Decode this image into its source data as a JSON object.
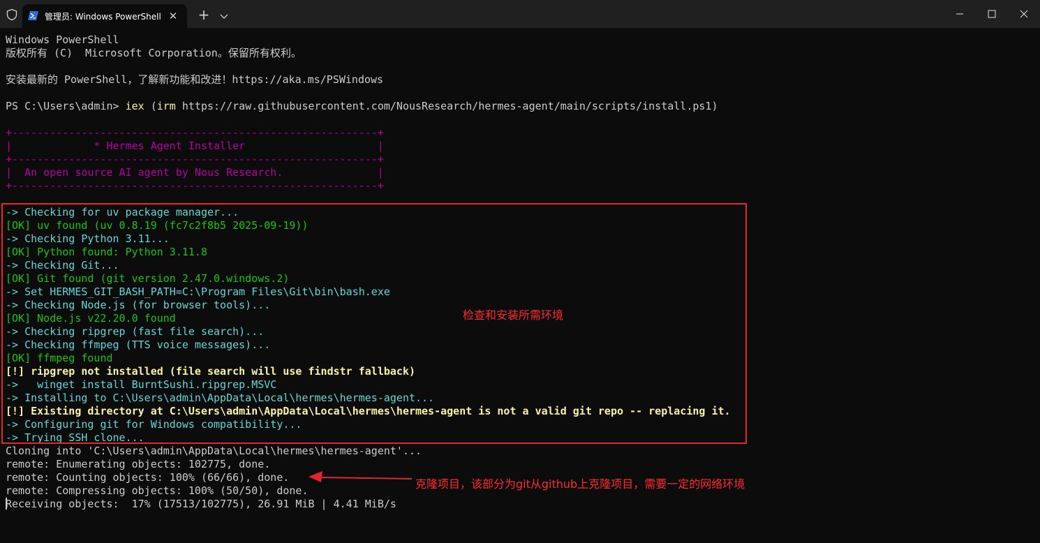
{
  "window": {
    "tab_title": "管理员: Windows PowerShell",
    "tab_close_glyph": "✕",
    "new_tab_glyph": "+",
    "icons": [
      "shield-icon",
      "powershell-icon",
      "close-icon",
      "plus-icon",
      "chevron-down-icon",
      "minimize-icon",
      "maximize-icon",
      "window-close-icon"
    ]
  },
  "terminal": {
    "lines": [
      "Windows PowerShell",
      "版权所有 (C)  Microsoft Corporation。保留所有权利。",
      "安装最新的 PowerShell，了解新功能和改进！https://aka.ms/PSWindows",
      "PS C:\\Users\\admin> ",
      "iex",
      " (",
      "irm",
      " https://raw.githubusercontent.com/NousResearch/hermes-agent/main/scripts/install.ps1)",
      "+----------------------------------------------------------+",
      "|             * Hermes Agent Installer                     |",
      "+----------------------------------------------------------+",
      "|  An open source AI agent by Nous Research.               |",
      "+----------------------------------------------------------+",
      "-> Checking for uv package manager...",
      "[OK] uv found (uv 0.8.19 (fc7c2f8b5 2025-09-19))",
      "-> Checking Python 3.11...",
      "[OK] Python found: Python 3.11.8",
      "-> Checking Git...",
      "[OK] Git found (git version 2.47.0.windows.2)",
      "-> Set HERMES_GIT_BASH_PATH=C:\\Program Files\\Git\\bin\\bash.exe",
      "-> Checking Node.js (for browser tools)...",
      "[OK] Node.js v22.20.0 found",
      "-> Checking ripgrep (fast file search)...",
      "-> Checking ffmpeg (TTS voice messages)...",
      "[OK] ffmpeg found",
      "[!] ripgrep not installed (file search will use findstr fallback)",
      "->   winget install BurntSushi.ripgrep.MSVC",
      "-> Installing to C:\\Users\\admin\\AppData\\Local\\hermes\\hermes-agent...",
      "[!] Existing directory at C:\\Users\\admin\\AppData\\Local\\hermes\\hermes-agent is not a valid git repo -- replacing it.",
      "-> Configuring git for Windows compatibility...",
      "-> Trying SSH clone...",
      "Cloning into 'C:\\Users\\admin\\AppData\\Local\\hermes\\hermes-agent'...",
      "remote: Enumerating objects: 102775, done.",
      "remote: Counting objects: 100% (66/66), done.",
      "remote: Compressing objects: 100% (50/50), done.",
      "Receiving objects:  17% (17513/102775), 26.91 MiB | 4.41 MiB/s"
    ]
  },
  "annotations": {
    "box_note": "检查和安装所需环境",
    "arrow_note": "克隆项目，该部分为git从github上克隆项目，需要一定的网络环境"
  },
  "colors": {
    "background": "#0c0c0c",
    "titlebar": "#202020",
    "text": "#cccccc",
    "cyan": "#61d6d6",
    "green": "#16c60c",
    "yellow": "#f9f1a5",
    "magenta": "#b4009e",
    "annotation_red": "#e3252c"
  }
}
